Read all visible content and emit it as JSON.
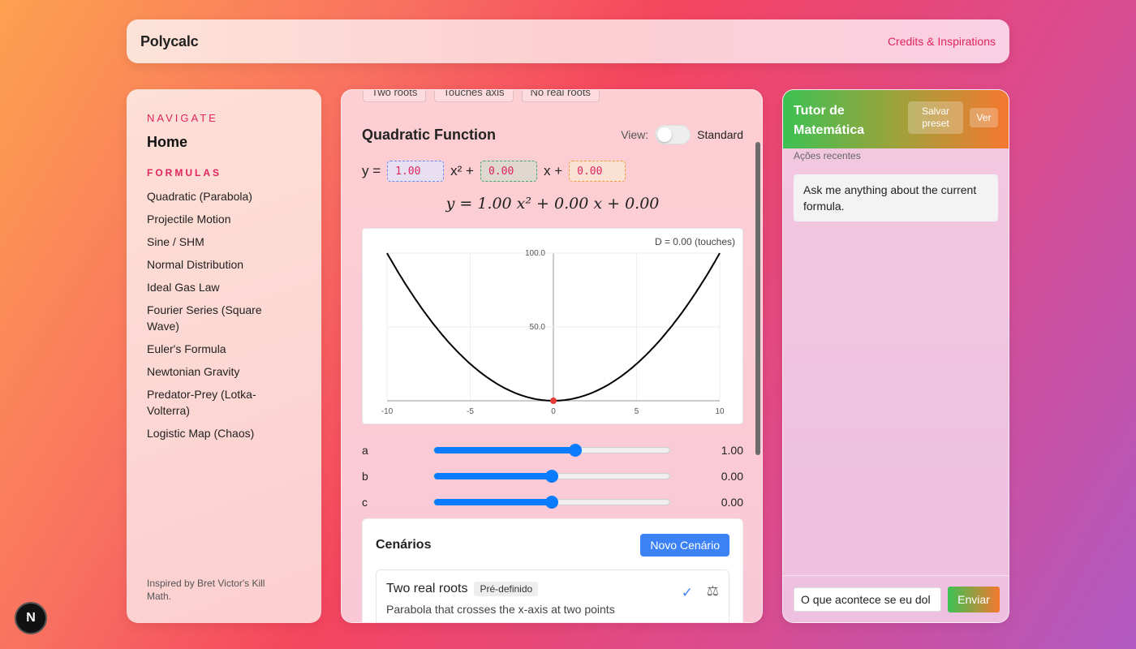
{
  "header": {
    "brand": "Polycalc",
    "credits_link": "Credits & Inspirations"
  },
  "sidebar": {
    "navigate_heading": "NAVIGATE",
    "home": "Home",
    "formulas_heading": "FORMULAS",
    "formulas": [
      "Quadratic (Parabola)",
      "Projectile Motion",
      "Sine / SHM",
      "Normal Distribution",
      "Ideal Gas Law",
      "Fourier Series (Square Wave)",
      "Euler's Formula",
      "Newtonian Gravity",
      "Predator-Prey (Lotka-Volterra)",
      "Logistic Map (Chaos)"
    ],
    "footer": "Inspired by Bret Victor's Kill Math."
  },
  "main": {
    "top_tabs": [
      "Two roots",
      "Touches axis",
      "No real roots"
    ],
    "title": "Quadratic Function",
    "view_label": "View:",
    "view_mode": "Standard",
    "equation": {
      "prefix": "y =",
      "a": "1.00",
      "x2": "x² +",
      "b": "0.00",
      "x1": "x +",
      "c": "0.00"
    },
    "latex_display": "y = 1.00 x² + 0.00 x + 0.00",
    "discriminant_label": "D = 0.00 (touches)",
    "sliders": [
      {
        "label": "a",
        "value": "1.00",
        "fraction": 0.6
      },
      {
        "label": "b",
        "value": "0.00",
        "fraction": 0.5
      },
      {
        "label": "c",
        "value": "0.00",
        "fraction": 0.5
      }
    ],
    "scenarios": {
      "title": "Cenários",
      "new_button": "Novo Cenário",
      "card": {
        "title": "Two real roots",
        "tag": "Pré-definido",
        "description": "Parabola that crosses the x-axis at two points"
      }
    }
  },
  "chart_data": {
    "type": "line",
    "function": "y = 1.00x^2 + 0.00x + 0.00",
    "x": [
      -10,
      -8,
      -6,
      -4,
      -2,
      0,
      2,
      4,
      6,
      8,
      10
    ],
    "y": [
      100,
      64,
      36,
      16,
      4,
      0,
      4,
      16,
      36,
      64,
      100
    ],
    "xlim": [
      -10,
      10
    ],
    "ylim": [
      0,
      100
    ],
    "x_ticks": [
      "-10",
      "-5",
      "0",
      "5",
      "10"
    ],
    "y_ticks": [
      "50.0",
      "100.0"
    ],
    "marked_point": {
      "x": 0,
      "y": 0
    },
    "grid": true,
    "annotation": "D = 0.00 (touches)",
    "line_color": "#000000",
    "point_color": "#e53935"
  },
  "tutor": {
    "title": "Tutor de Matemática",
    "save_preset": "Salvar preset",
    "view_button": "Ver",
    "recent_actions": "Ações recentes",
    "message": "Ask me anything about the current formula.",
    "input_value": "O que acontece se eu dol",
    "send_button": "Enviar"
  },
  "badge": {
    "letter": "N"
  }
}
